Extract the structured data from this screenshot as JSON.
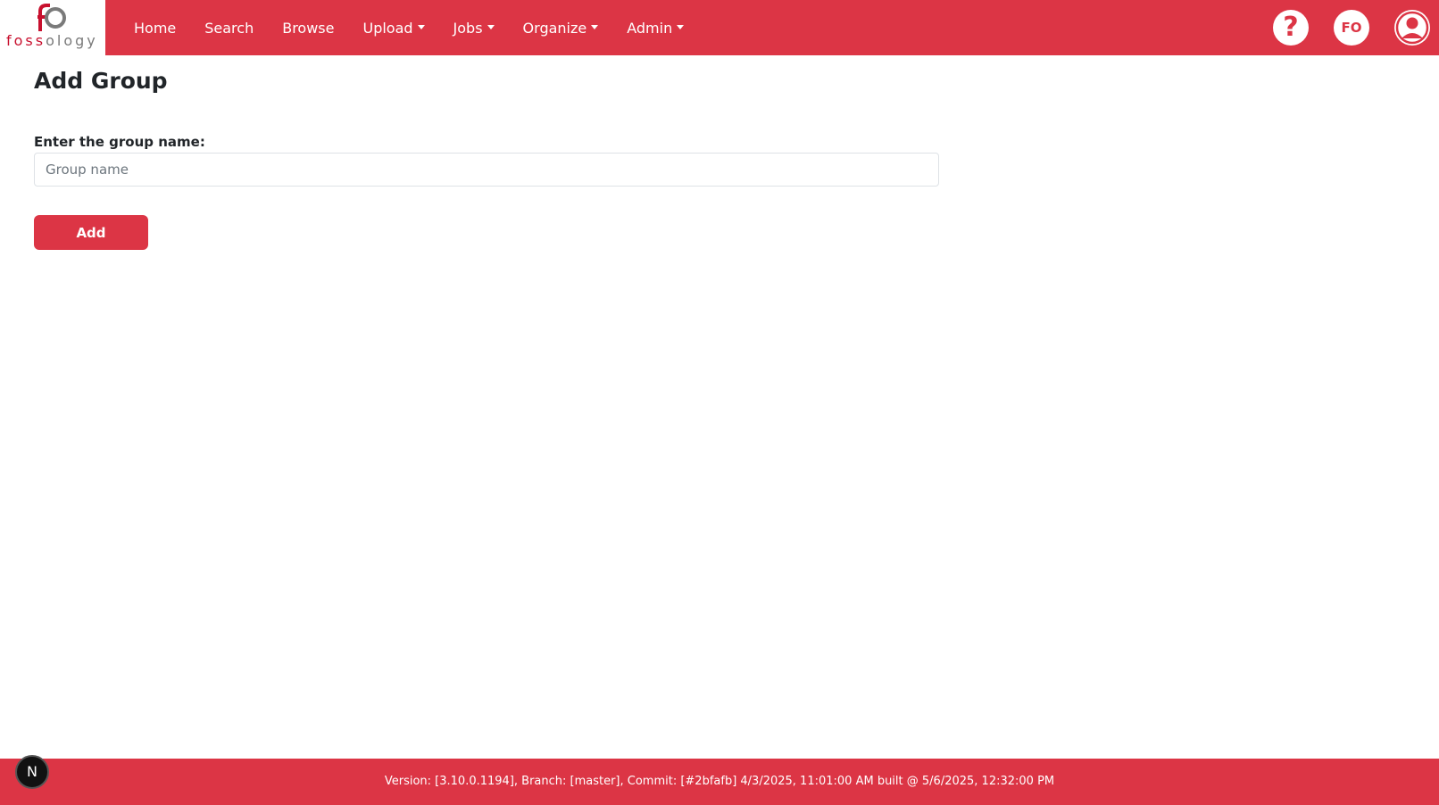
{
  "brand": {
    "logo_text_red": "foss",
    "logo_text_gray": "ology",
    "accent_color": "#dc3545"
  },
  "nav": {
    "items": [
      {
        "label": "Home",
        "dropdown": false
      },
      {
        "label": "Search",
        "dropdown": false
      },
      {
        "label": "Browse",
        "dropdown": false
      },
      {
        "label": "Upload",
        "dropdown": true
      },
      {
        "label": "Jobs",
        "dropdown": true
      },
      {
        "label": "Organize",
        "dropdown": true
      },
      {
        "label": "Admin",
        "dropdown": true
      }
    ],
    "help_icon": "question-mark-icon",
    "help_label": "?",
    "user_initials": "FO",
    "avatar_icon": "user-circle-icon"
  },
  "main": {
    "title": "Add Group",
    "field_label": "Enter the group name:",
    "input_placeholder": "Group name",
    "input_value": "",
    "add_button_label": "Add"
  },
  "footer": {
    "version_text": "Version: [3.10.0.1194], Branch: [master], Commit: [#2bfafb] 4/3/2025, 11:01:00 AM built @ 5/6/2025, 12:32:00 PM"
  },
  "dev_badge": {
    "label": "N"
  }
}
